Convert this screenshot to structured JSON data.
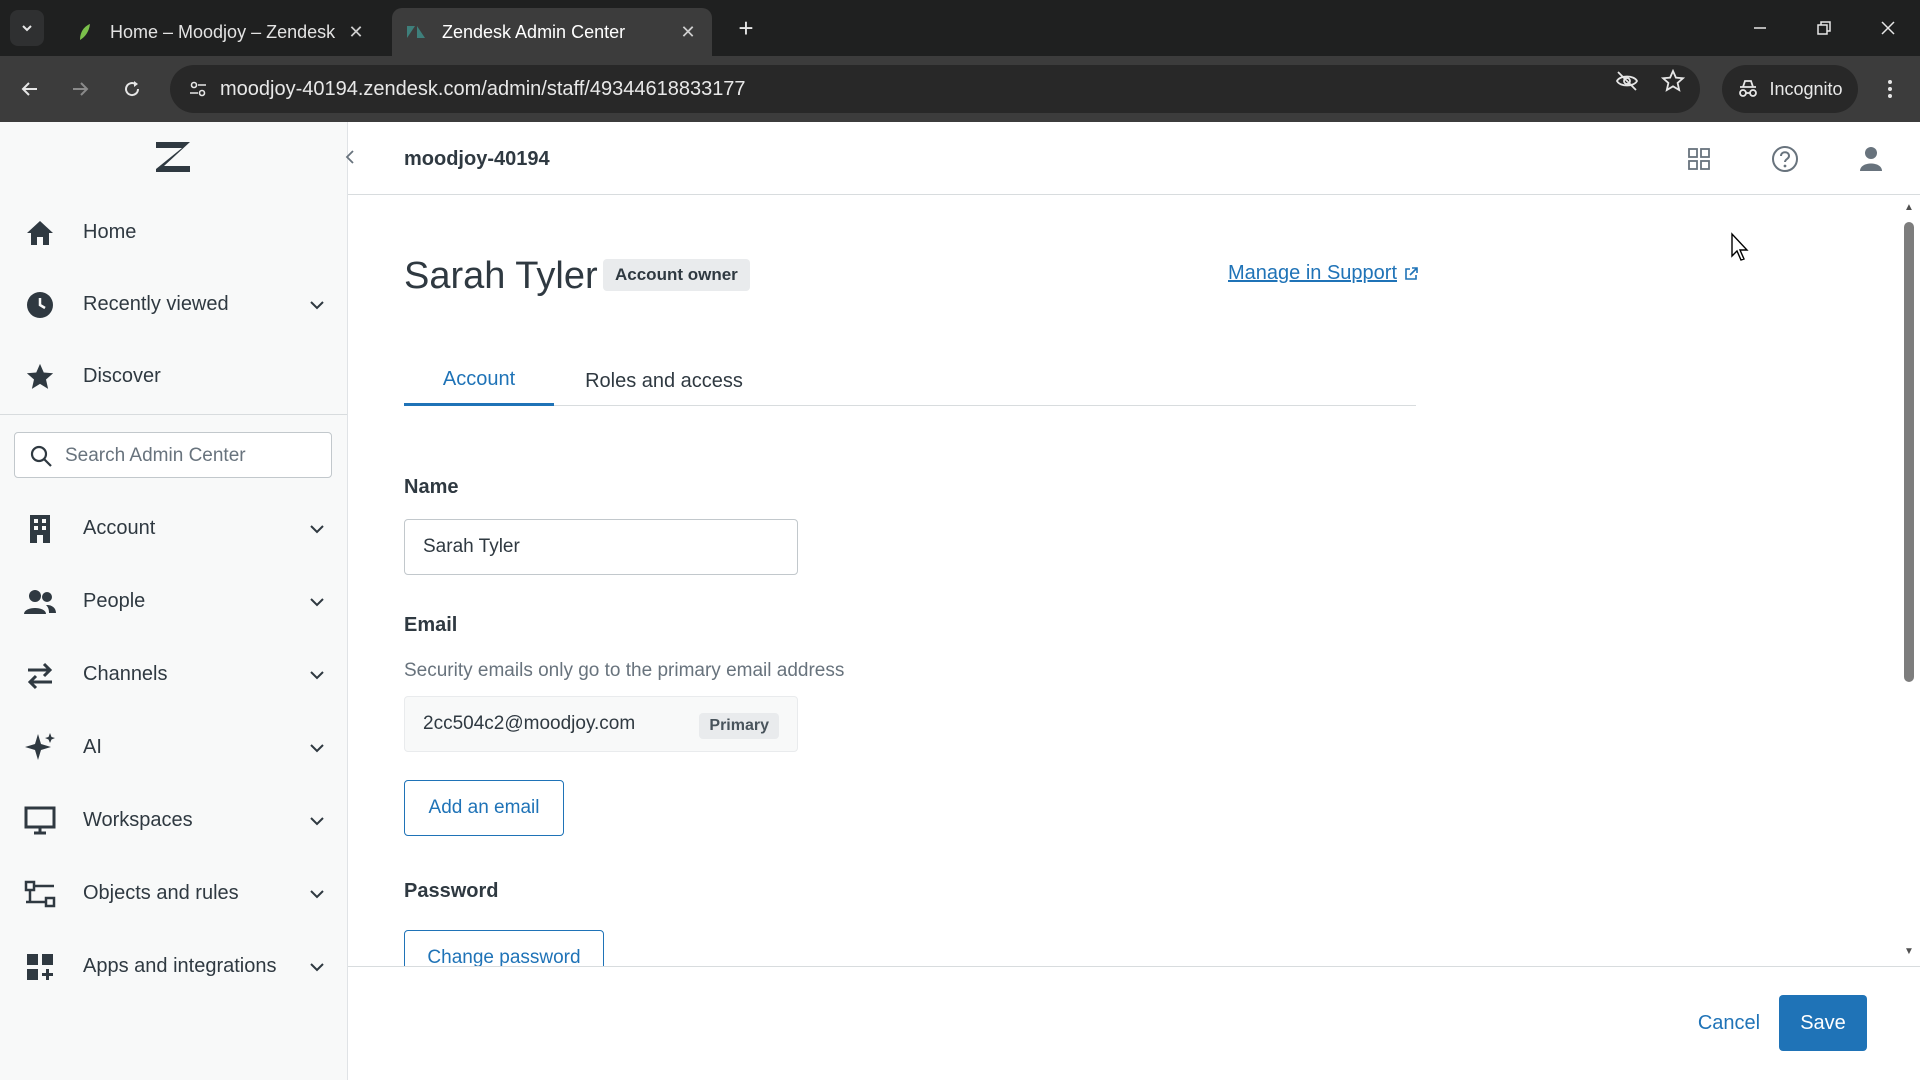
{
  "browser": {
    "tabs": [
      {
        "title": "Home – Moodjoy – Zendesk",
        "active": false
      },
      {
        "title": "Zendesk Admin Center",
        "active": true
      }
    ],
    "url": "moodjoy-40194.zendesk.com/admin/staff/49344618833177",
    "incognito_label": "Incognito"
  },
  "sidebar": {
    "top_items": [
      {
        "label": "Home",
        "icon": "home-icon"
      },
      {
        "label": "Recently viewed",
        "icon": "clock-icon",
        "expandable": true
      },
      {
        "label": "Discover",
        "icon": "star-icon"
      }
    ],
    "search_placeholder": "Search Admin Center",
    "sections": [
      {
        "label": "Account",
        "icon": "building-icon"
      },
      {
        "label": "People",
        "icon": "people-icon"
      },
      {
        "label": "Channels",
        "icon": "arrows-icon"
      },
      {
        "label": "AI",
        "icon": "sparkle-icon"
      },
      {
        "label": "Workspaces",
        "icon": "monitor-icon"
      },
      {
        "label": "Objects and rules",
        "icon": "objects-icon"
      },
      {
        "label": "Apps and integrations",
        "icon": "apps-icon"
      }
    ]
  },
  "header": {
    "subdomain": "moodjoy-40194"
  },
  "user": {
    "name": "Sarah Tyler",
    "badge": "Account owner",
    "manage_link": "Manage in Support"
  },
  "tabs": [
    {
      "label": "Account",
      "selected": true
    },
    {
      "label": "Roles and access",
      "selected": false
    }
  ],
  "form": {
    "name_label": "Name",
    "name_value": "Sarah Tyler",
    "email_label": "Email",
    "email_hint": "Security emails only go to the primary email address",
    "email_value": "2cc504c2@moodjoy.com",
    "email_tag": "Primary",
    "add_email_label": "Add an email",
    "password_label": "Password",
    "change_password_label": "Change password"
  },
  "footer": {
    "cancel_label": "Cancel",
    "save_label": "Save"
  },
  "colors": {
    "accent": "#1f73b7",
    "text": "#2f3941",
    "sidebar_bg": "#f8f9f9",
    "chrome_bg": "#1f2020"
  }
}
